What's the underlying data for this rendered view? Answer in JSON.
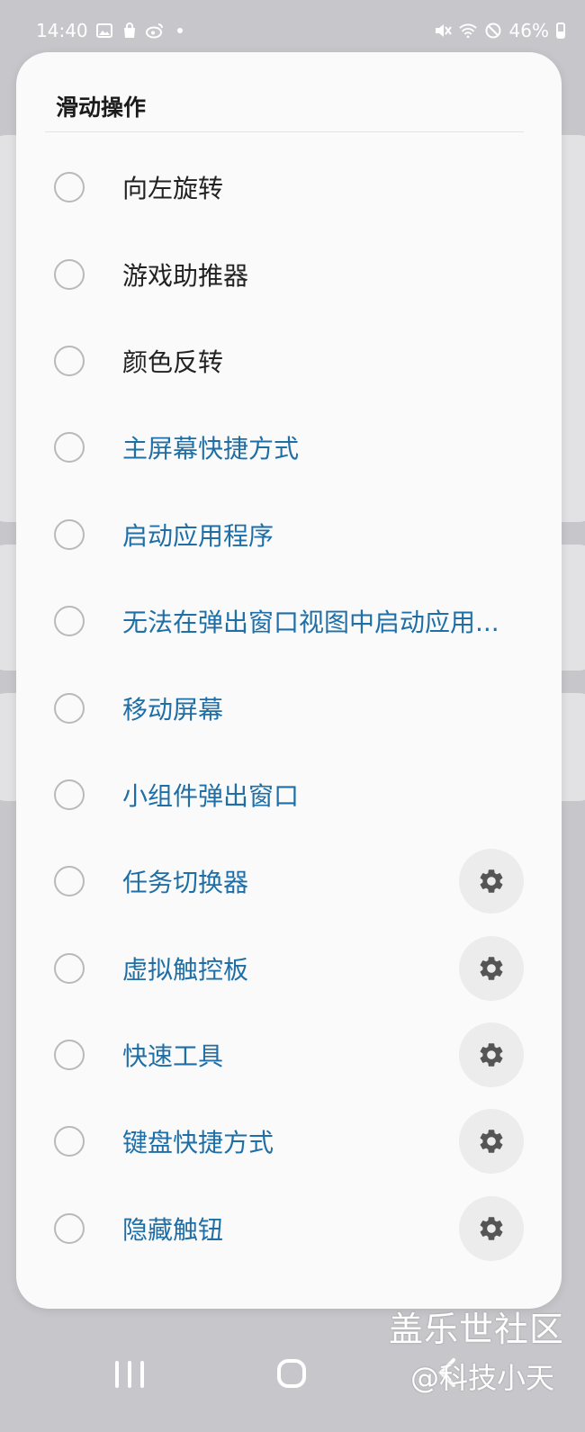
{
  "status_bar": {
    "time": "14:40",
    "battery_percent": "46%",
    "left_icons": [
      "image-icon",
      "shopping-bag-icon",
      "weibo-icon",
      "dot-icon"
    ],
    "right_icons": [
      "mute-icon",
      "wifi-icon",
      "do-not-disturb-icon",
      "battery-icon"
    ]
  },
  "dialog": {
    "title": "滑动操作",
    "options": [
      {
        "label": "向左旋转",
        "selected": false,
        "has_settings": false,
        "color": "#222222"
      },
      {
        "label": "游戏助推器",
        "selected": false,
        "has_settings": false,
        "color": "#222222"
      },
      {
        "label": "颜色反转",
        "selected": false,
        "has_settings": false,
        "color": "#222222"
      },
      {
        "label": "主屏幕快捷方式",
        "selected": false,
        "has_settings": false,
        "color": "#1f6fa6"
      },
      {
        "label": "启动应用程序",
        "selected": false,
        "has_settings": false,
        "color": "#1f6fa6"
      },
      {
        "label": "无法在弹出窗口视图中启动应用...",
        "selected": false,
        "has_settings": false,
        "color": "#1f6fa6"
      },
      {
        "label": "移动屏幕",
        "selected": false,
        "has_settings": false,
        "color": "#1f6fa6"
      },
      {
        "label": "小组件弹出窗口",
        "selected": false,
        "has_settings": false,
        "color": "#1f6fa6"
      },
      {
        "label": "任务切换器",
        "selected": false,
        "has_settings": true,
        "color": "#1f6fa6"
      },
      {
        "label": "虚拟触控板",
        "selected": false,
        "has_settings": true,
        "color": "#1f6fa6"
      },
      {
        "label": "快速工具",
        "selected": false,
        "has_settings": true,
        "color": "#1f6fa6"
      },
      {
        "label": "键盘快捷方式",
        "selected": false,
        "has_settings": true,
        "color": "#1f6fa6"
      },
      {
        "label": "隐藏触钮",
        "selected": false,
        "has_settings": true,
        "color": "#1f6fa6"
      }
    ]
  },
  "navigation": {
    "icons": [
      "recents-icon",
      "home-icon",
      "back-icon"
    ]
  },
  "watermark": {
    "line1": "盖乐世社区",
    "line2": "@科技小天"
  },
  "colors": {
    "background": "#c7c7cb",
    "dialog": "#fafafa",
    "accent_text": "#1f6fa6",
    "gear": "#555555"
  }
}
